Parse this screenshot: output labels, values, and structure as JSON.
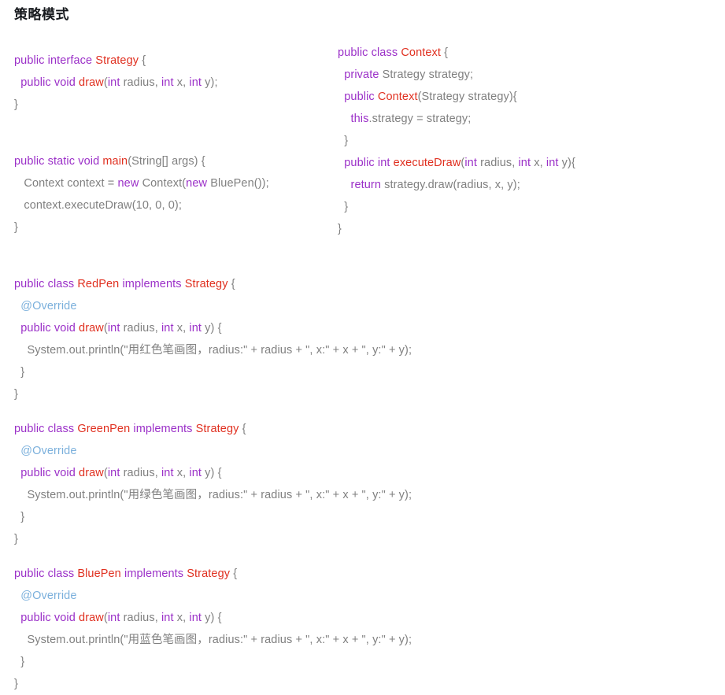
{
  "page": {
    "title": "策略模式",
    "background_color": "#ffffff"
  },
  "theme": {
    "keyword_color": "#9b30c8",
    "declaration_color": "#e03020",
    "plain_color": "#808080",
    "annotation_color": "#7bb0dc",
    "title_color": "#16191d"
  },
  "code": {
    "left_column": {
      "blocks": [
        {
          "name": "strategy-interface",
          "lines": [
            "public interface Strategy {",
            "  public void draw(int radius, int x, int y);",
            "}"
          ]
        },
        {
          "name": "main-method",
          "lines": [
            "public static void main(String[] args) {",
            "   Context context = new Context(new BluePen());",
            "   context.executeDraw(10, 0, 0);",
            "}"
          ]
        },
        {
          "name": "redpen-class",
          "lines": [
            "public class RedPen implements Strategy {",
            "  @Override",
            "  public void draw(int radius, int x, int y) {",
            "    System.out.println(\"用红色笔画图，radius:\" + radius + \", x:\" + x + \", y:\" + y);",
            "  }",
            "}"
          ]
        },
        {
          "name": "greenpen-class",
          "lines": [
            "public class GreenPen implements Strategy {",
            "  @Override",
            "  public void draw(int radius, int x, int y) {",
            "    System.out.println(\"用绿色笔画图，radius:\" + radius + \", x:\" + x + \", y:\" + y);",
            "  }",
            "}"
          ]
        },
        {
          "name": "bluepen-class",
          "lines": [
            "public class BluePen implements Strategy {",
            "  @Override",
            "  public void draw(int radius, int x, int y) {",
            "    System.out.println(\"用蓝色笔画图，radius:\" + radius + \", x:\" + x + \", y:\" + y);",
            "  }",
            "}"
          ]
        }
      ]
    },
    "right_column": {
      "blocks": [
        {
          "name": "context-class",
          "lines": [
            "public class Context {",
            "  private Strategy strategy;",
            "  public Context(Strategy strategy){",
            "    this.strategy = strategy;",
            "  }",
            "  public int executeDraw(int radius, int x, int y){",
            "    return strategy.draw(radius, x, y);",
            "  }",
            "}"
          ]
        }
      ]
    }
  },
  "tokens": {
    "keywords": [
      "public",
      "private",
      "static",
      "class",
      "interface",
      "implements",
      "void",
      "int",
      "new",
      "this",
      "return"
    ],
    "declarations": [
      "Strategy",
      "Context",
      "RedPen",
      "GreenPen",
      "BluePen",
      "draw",
      "main",
      "executeDraw"
    ],
    "annotations": [
      "@Override"
    ]
  }
}
